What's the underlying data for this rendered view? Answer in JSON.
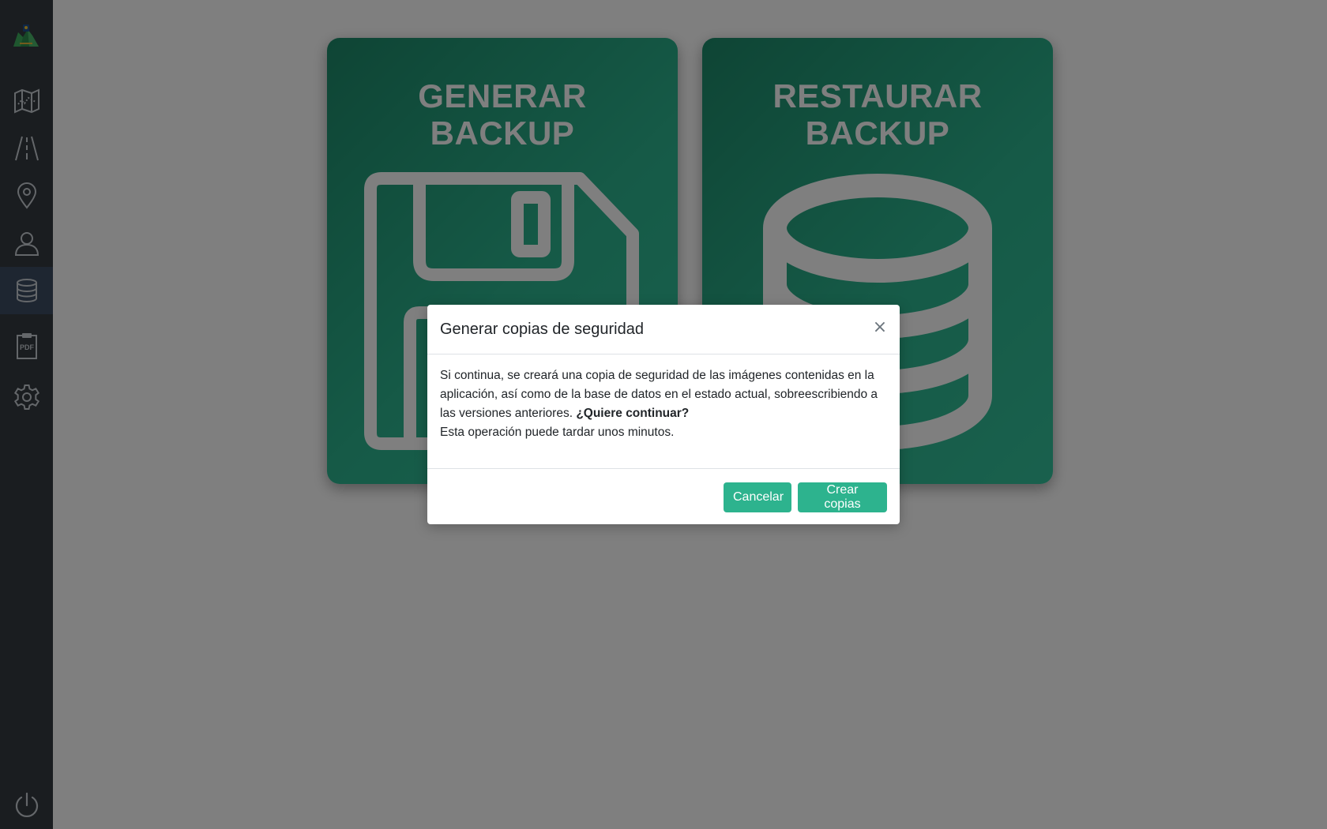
{
  "sidebar": {
    "logo": "app-logo",
    "items": [
      {
        "icon": "map-icon",
        "active": false
      },
      {
        "icon": "road-icon",
        "active": false
      },
      {
        "icon": "location-pin-icon",
        "active": false
      },
      {
        "icon": "user-icon",
        "active": false
      },
      {
        "icon": "database-icon",
        "active": true
      },
      {
        "icon": "pdf-icon",
        "active": false,
        "label": "PDF"
      },
      {
        "icon": "gear-icon",
        "active": false
      }
    ],
    "bottom_icon": "power-icon"
  },
  "cards": {
    "generate": {
      "line1": "GENERAR",
      "line2": "BACKUP",
      "icon": "floppy-disk-icon"
    },
    "restore": {
      "line1": "RESTAURAR",
      "line2": "BACKUP",
      "icon": "database-icon"
    }
  },
  "modal": {
    "title": "Generar copias de seguridad",
    "close": "×",
    "body_text": "Si continua, se creará una copia de seguridad de las imágenes contenidas en la aplicación, así como de la base de datos en el estado actual, sobreescribiendo a las versiones anteriores.",
    "body_question": "¿Quiere continuar?",
    "body_note": "Esta operación puede tardar unos minutos.",
    "cancel_label": "Cancelar",
    "confirm_label": "Crear copias"
  },
  "colors": {
    "sidebar_bg": "#343a40",
    "sidebar_active": "#3d4d62",
    "card_green": "#2cb58f",
    "button_green": "#2db38e"
  }
}
